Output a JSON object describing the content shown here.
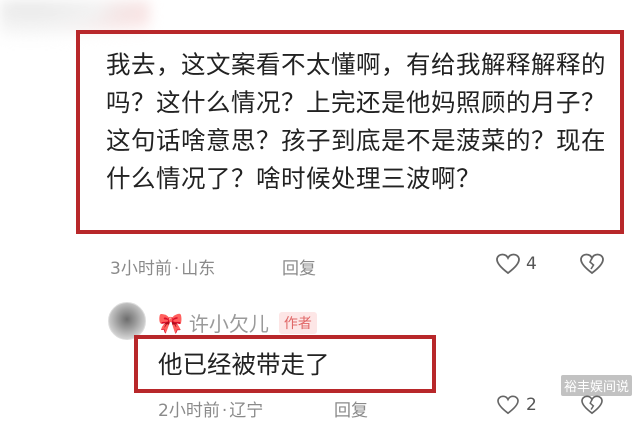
{
  "comment": {
    "text": "我去，这文案看不太懂啊，有给我解释解释的吗？这什么情况？上完还是他妈照顾的月子？这句话啥意思？孩子到底是不是菠菜的？现在什么情况了？啥时候处理三波啊？",
    "time": "3小时前",
    "location": "山东",
    "reply_label": "回复",
    "like_count": "4",
    "like_icon": "heart-outline-icon",
    "dislike_icon": "broken-heart-icon"
  },
  "reply": {
    "username": "许小欠儿",
    "author_badge": "作者",
    "text": "他已经被带走了",
    "time": "2小时前",
    "location": "辽宁",
    "reply_label": "回复",
    "like_count": "2",
    "bow_icon": "bow-icon",
    "like_icon": "heart-outline-icon",
    "dislike_icon": "broken-heart-icon"
  },
  "watermark": "裕丰娱间说",
  "colors": {
    "highlight_box": "#b8272a",
    "author_badge_bg": "#fde6e6",
    "author_badge_text": "#e06666"
  }
}
